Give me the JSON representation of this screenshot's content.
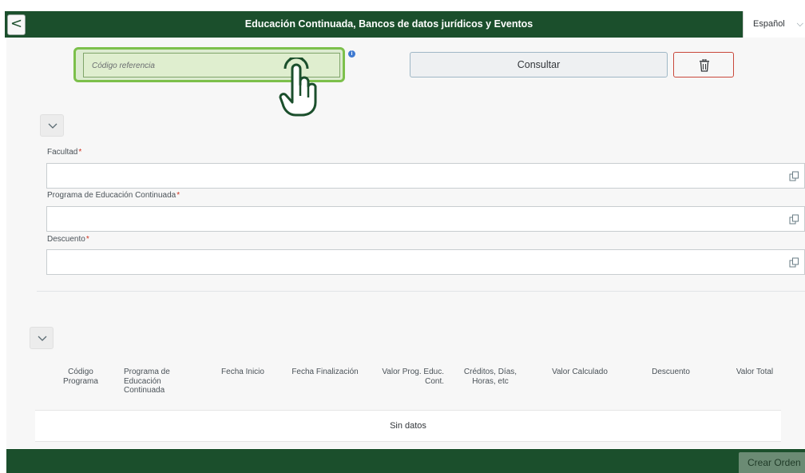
{
  "header": {
    "back_glyph": "<",
    "title": "Educación Continuada, Bancos de datos jurídicos y Eventos",
    "language": "Español",
    "language_chevron": "⌵"
  },
  "search": {
    "reference_placeholder": "Código referencia",
    "info_glyph": "i",
    "consultar_label": "Consultar",
    "delete_icon": "trash-icon",
    "pointer_icon": "hand-pointer-icon"
  },
  "form": {
    "facultad_label": "Facultad",
    "programa_label": "Programa de Educación Continuada",
    "descuento_label": "Descuento",
    "required_mark": "*",
    "value_help_icon": "value-help-icon"
  },
  "table": {
    "columns": [
      "Código Programa",
      "Programa de Educación Continuada",
      "Fecha Inicio",
      "Fecha Finalización",
      "Valor Prog. Educ. Cont.",
      "Créditos, Días, Horas, etc",
      "Valor Calculado",
      "Descuento",
      "Valor Total"
    ],
    "col_lines": [
      [
        "Código",
        "Programa"
      ],
      [
        "Programa de",
        "Educación",
        "Continuada"
      ],
      [
        "Fecha Inicio"
      ],
      [
        "Fecha Finalización"
      ],
      [
        "Valor Prog. Educ.",
        "Cont."
      ],
      [
        "Créditos, Días,",
        "Horas, etc"
      ],
      [
        "Valor Calculado"
      ],
      [
        "Descuento"
      ],
      [
        "Valor Total"
      ]
    ],
    "empty_text": "Sin datos"
  },
  "footer": {
    "crear_label": "Crear Orden"
  },
  "colors": {
    "brand_green": "#1b4f2c",
    "highlight_green": "#7cc04b",
    "required_red": "#d0321f",
    "delete_border": "#c9483b"
  }
}
